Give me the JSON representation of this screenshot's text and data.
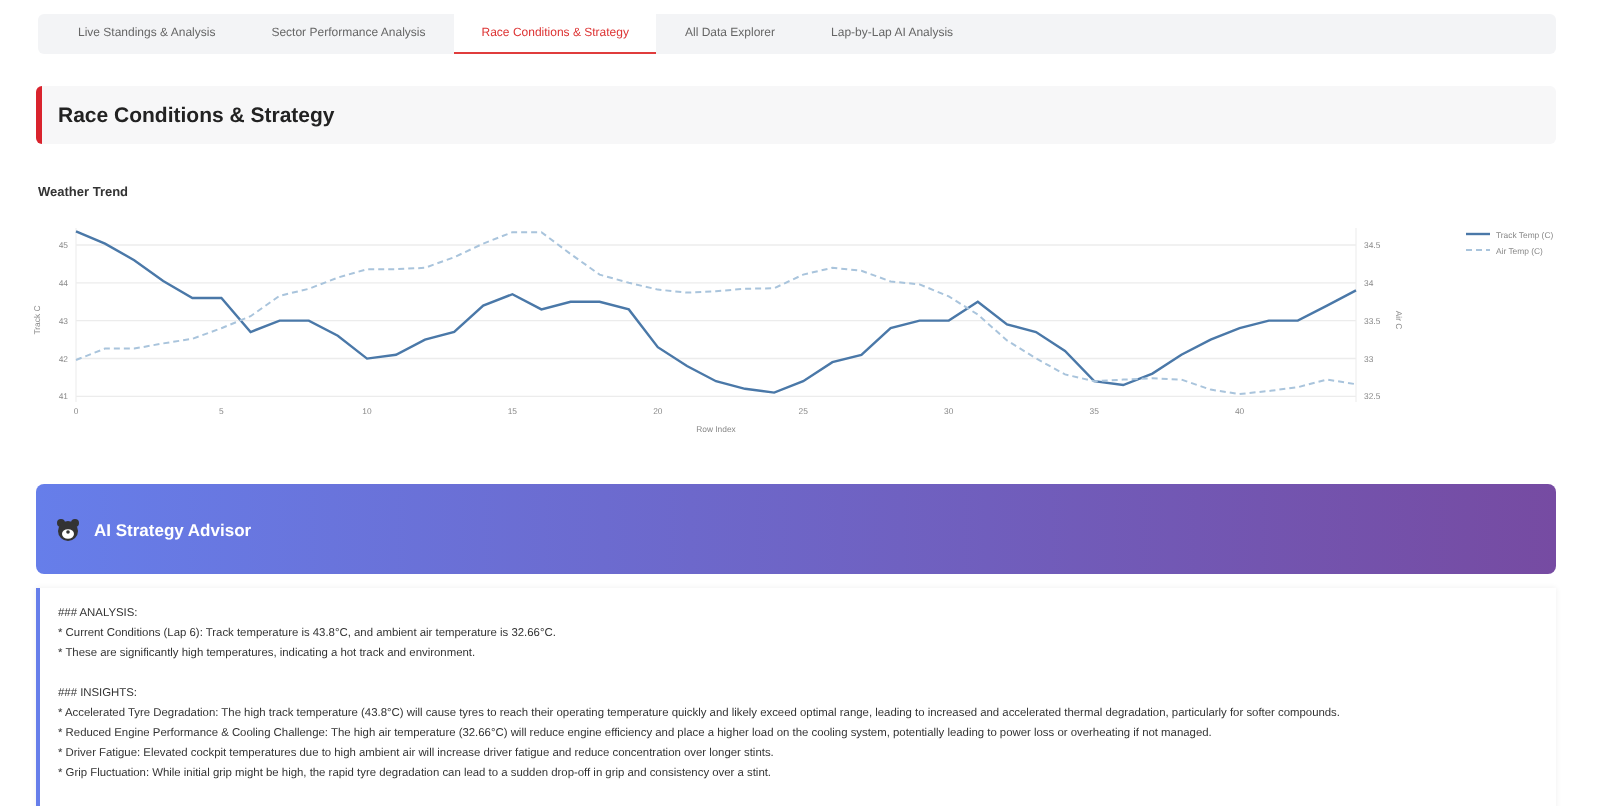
{
  "tabs": [
    {
      "label": "Live Standings & Analysis",
      "selected": false
    },
    {
      "label": "Sector Performance Analysis",
      "selected": false
    },
    {
      "label": "Race Conditions & Strategy",
      "selected": true
    },
    {
      "label": "All Data Explorer",
      "selected": false
    },
    {
      "label": "Lap-by-Lap AI Analysis",
      "selected": false
    }
  ],
  "section_title": "Race Conditions & Strategy",
  "weather_trend": {
    "title": "Weather Trend",
    "chart_data": {
      "type": "line",
      "xlabel": "Row Index",
      "ylabel": "Track C",
      "y2label": "Air C",
      "y2ticks": [
        32.5,
        33,
        33.5,
        34,
        34.5
      ],
      "grid": true,
      "legend": true,
      "xlim": [
        0,
        44
      ],
      "ylim": [
        40.85,
        45.45
      ],
      "y2lim": [
        32.425,
        34.725
      ],
      "x": [
        0,
        1,
        2,
        3,
        4,
        5,
        6,
        7,
        8,
        9,
        10,
        11,
        12,
        13,
        14,
        15,
        16,
        17,
        18,
        19,
        20,
        21,
        22,
        23,
        24,
        25,
        26,
        27,
        28,
        29,
        30,
        31,
        32,
        33,
        34,
        35,
        36,
        37,
        38,
        39,
        40,
        41,
        42,
        43,
        44
      ],
      "xticks": [
        0,
        5,
        10,
        15,
        20,
        25,
        30,
        35,
        40
      ],
      "yticks": [
        41,
        42,
        43,
        44,
        45
      ],
      "series": [
        {
          "name": "Track Temp (C)",
          "color": "#4a78a8",
          "line_style": "solid",
          "values": [
            45.36,
            45.04,
            44.6,
            44.05,
            43.6,
            43.6,
            42.7,
            43.0,
            43.0,
            42.6,
            42.0,
            42.1,
            42.5,
            42.7,
            43.4,
            43.7,
            43.3,
            43.5,
            43.5,
            43.3,
            42.3,
            41.8,
            41.4,
            41.2,
            41.1,
            41.4,
            41.9,
            42.1,
            42.8,
            43.0,
            43.0,
            43.5,
            42.9,
            42.7,
            42.2,
            41.4,
            41.3,
            41.6,
            42.1,
            42.5,
            42.8,
            43.0,
            43.0,
            43.4,
            43.8
          ]
        },
        {
          "name": "Air Temp (C)",
          "color": "#a9c4dc",
          "line_style": "dashed",
          "axis": "y2",
          "values": [
            32.98,
            33.13,
            33.13,
            33.2,
            33.26,
            33.4,
            33.56,
            33.83,
            33.92,
            34.07,
            34.18,
            34.18,
            34.2,
            34.34,
            34.52,
            34.67,
            34.67,
            34.38,
            34.11,
            34.0,
            33.91,
            33.87,
            33.89,
            33.92,
            33.93,
            34.11,
            34.2,
            34.16,
            34.02,
            33.98,
            33.82,
            33.58,
            33.24,
            33.0,
            32.79,
            32.7,
            32.72,
            32.74,
            32.72,
            32.59,
            32.53,
            32.57,
            32.62,
            32.72,
            32.66
          ]
        }
      ]
    }
  },
  "advisor": {
    "title": "AI Strategy Advisor",
    "lines": [
      {
        "kind": "heading",
        "text": "### ANALYSIS:"
      },
      {
        "kind": "bullet",
        "text": "* Current Conditions (Lap 6): Track temperature is 43.8°C, and ambient air temperature is 32.66°C."
      },
      {
        "kind": "bullet",
        "text": "* These are significantly high temperatures, indicating a hot track and environment."
      },
      {
        "kind": "heading",
        "text": "### INSIGHTS:"
      },
      {
        "kind": "bullet",
        "text": "* Accelerated Tyre Degradation: The high track temperature (43.8°C) will cause tyres to reach their operating temperature quickly and likely exceed optimal range, leading to increased and accelerated thermal degradation, particularly for softer compounds."
      },
      {
        "kind": "bullet",
        "text": "* Reduced Engine Performance & Cooling Challenge: The high air temperature (32.66°C) will reduce engine efficiency and place a higher load on the cooling system, potentially leading to power loss or overheating if not managed."
      },
      {
        "kind": "bullet",
        "text": "* Driver Fatigue: Elevated cockpit temperatures due to high ambient air will increase driver fatigue and reduce concentration over longer stints."
      },
      {
        "kind": "bullet",
        "text": "* Grip Fluctuation: While initial grip might be high, the rapid tyre degradation can lead to a sudden drop-off in grip and consistency over a stint."
      }
    ]
  }
}
